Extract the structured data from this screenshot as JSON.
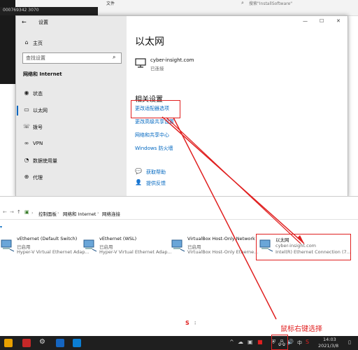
{
  "bg": {
    "explorer_tab_text": "文件",
    "search_placeholder": "搜索\"InstallSoftware\"",
    "dark_strip_text": "000769342 3070"
  },
  "settings": {
    "title": "设置",
    "home_label": "主页",
    "search_placeholder": "查找设置",
    "section_title": "网络和 Internet",
    "nav": [
      {
        "icon": "home-icon",
        "label": "状态"
      },
      {
        "icon": "ethernet-icon",
        "label": "以太网"
      },
      {
        "icon": "phone-icon",
        "label": "拨号"
      },
      {
        "icon": "vpn-icon",
        "label": "VPN"
      },
      {
        "icon": "data-usage-icon",
        "label": "数据使用量"
      },
      {
        "icon": "proxy-icon",
        "label": "代理"
      }
    ],
    "page_title": "以太网",
    "network_name": "cyber-insight.com",
    "network_status": "已连接",
    "related_title": "相关设置",
    "related_links": [
      "更改适配器选项",
      "更改高级共享设置",
      "网络和共享中心",
      "Windows 防火墙"
    ],
    "help_label": "获取帮助",
    "feedback_label": "提供反馈",
    "window_controls": {
      "minimize": "—",
      "maximize": "☐",
      "close": "✕"
    }
  },
  "netconn": {
    "breadcrumb": [
      "控制面板",
      "网络和 Internet",
      "网络连接"
    ],
    "adapters": [
      {
        "name": "vEthernet (Default Switch)",
        "status": "已启用",
        "device": "Hyper-V Virtual Ethernet Adap..."
      },
      {
        "name": "vEthernet (WSL)",
        "status": "已启用",
        "device": "Hyper-V Virtual Ethernet Adap..."
      },
      {
        "name": "VirtualBox Host-Only Network",
        "status": "已启用",
        "device": "VirtualBox Host-Only Etherne..."
      },
      {
        "name": "以太网",
        "status": "cyber-insight.com",
        "device": "Intel(R) Ethernet Connection (7..."
      }
    ]
  },
  "annotation": {
    "right_click_text": "鼠标右键选择",
    "colors": {
      "annotation": "#e02020",
      "accent": "#0067c0"
    }
  },
  "taskbar": {
    "ime": "中",
    "time": "14:03",
    "date": "2021/3/8"
  }
}
